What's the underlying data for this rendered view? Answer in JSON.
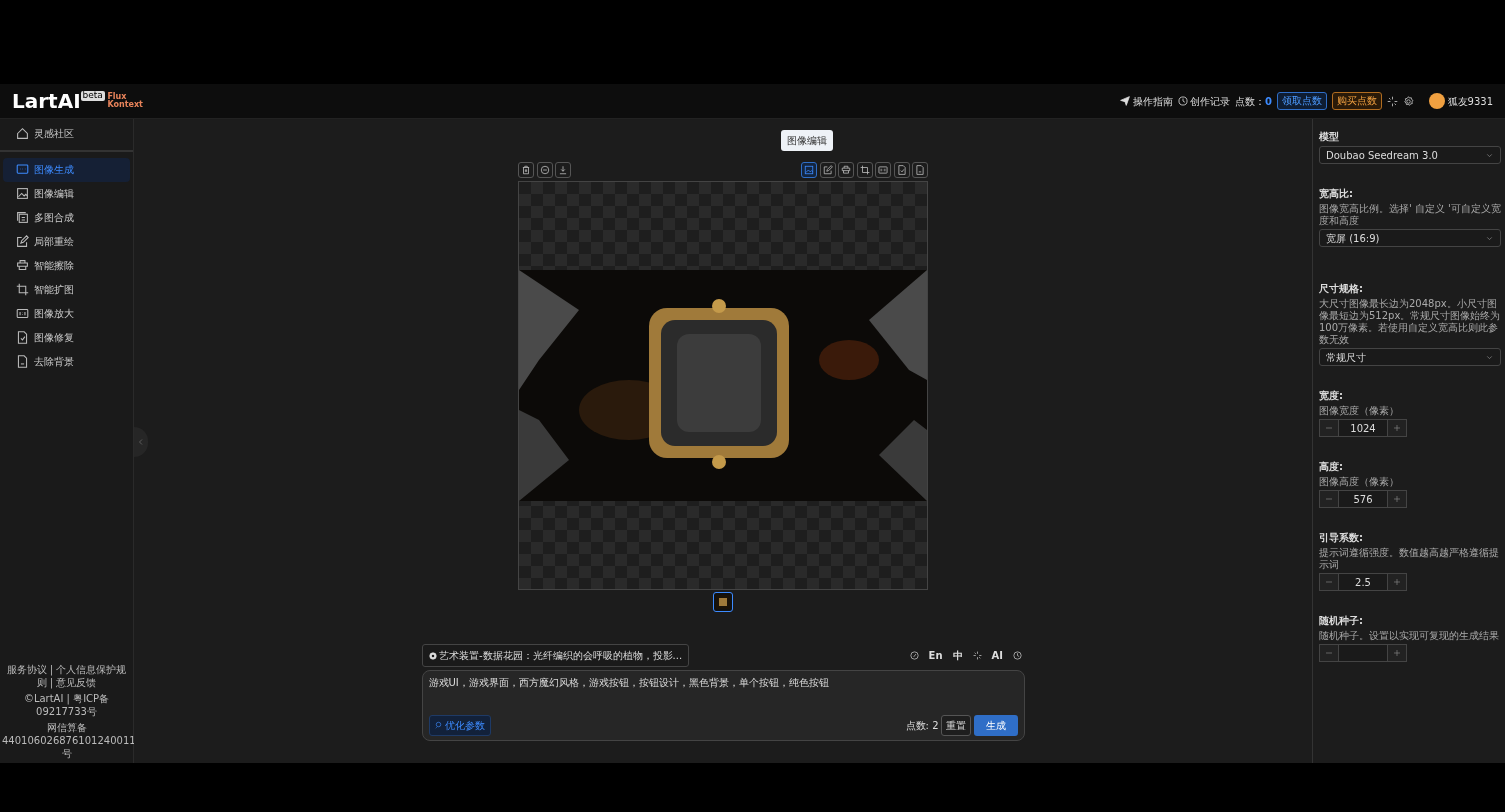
{
  "header": {
    "logo": "LartAI",
    "logo_badge": "beta",
    "product": [
      "Flux",
      "Kontext"
    ],
    "links": [
      {
        "label": "操作指南"
      },
      {
        "label": "创作记录"
      }
    ],
    "points_label": "点数：",
    "points_value": "0",
    "buttons": [
      {
        "label": "领取点数",
        "kind": "claim"
      },
      {
        "label": "购买点数",
        "kind": "buy"
      }
    ],
    "username": "狐友9331"
  },
  "sidebar": {
    "top": {
      "label": "灵感社区"
    },
    "items": [
      {
        "label": "图像生成",
        "selected": true
      },
      {
        "label": "图像编辑",
        "selected": false
      },
      {
        "label": "多图合成",
        "selected": false
      },
      {
        "label": "局部重绘",
        "selected": false
      },
      {
        "label": "智能擦除",
        "selected": false
      },
      {
        "label": "智能扩图",
        "selected": false
      },
      {
        "label": "图像放大",
        "selected": false
      },
      {
        "label": "图像修复",
        "selected": false
      },
      {
        "label": "去除背景",
        "selected": false
      }
    ],
    "footer": [
      "服务协议 | 个人信息保护规则 | 意见反馈",
      "©LartAI | 粤ICP备09217733号",
      "网信算备440106026876101240011号"
    ]
  },
  "toolbar": {
    "left": [
      {
        "selected": false
      },
      {
        "selected": false
      },
      {
        "selected": false
      }
    ],
    "right": [
      {
        "selected": true
      },
      {
        "selected": false
      },
      {
        "selected": false
      },
      {
        "selected": false
      },
      {
        "selected": false
      },
      {
        "selected": false
      },
      {
        "selected": false
      }
    ],
    "tooltip": "图像编辑"
  },
  "canvas": {
    "thumbnails": [
      {
        "selected": true
      }
    ]
  },
  "prompt": {
    "template": "艺术装置-数据花园：光纤编织的会呼吸的植物，投影...",
    "tools": [
      "En",
      "中",
      "AI"
    ],
    "value": "游戏UI，游戏界面，西方魔幻风格，游戏按钮，按钮设计，黑色背景，单个按钮，纯色按钮",
    "optimize": "优化参数",
    "cost": "点数: 2",
    "reset": "重置",
    "generate": "生成"
  },
  "settings": [
    {
      "kind": "select",
      "label": "模型",
      "value": "Doubao Seedream 3.0"
    },
    {
      "kind": "select",
      "label": "宽高比:",
      "help": "图像宽高比例。选择' 自定义 '可自定义宽度和高度",
      "value": "宽屏 (16:9)"
    },
    {
      "kind": "select",
      "label": "尺寸规格:",
      "help": "大尺寸图像最长边为2048px。小尺寸图像最短边为512px。常规尺寸图像始终为100万像素。若使用自定义宽高比则此参数无效",
      "value": "常规尺寸"
    },
    {
      "kind": "stepper",
      "label": "宽度:",
      "help": "图像宽度（像素）",
      "value": "1024"
    },
    {
      "kind": "stepper",
      "label": "高度:",
      "help": "图像高度（像素）",
      "value": "576"
    },
    {
      "kind": "stepper",
      "label": "引导系数:",
      "help": "提示词遵循强度。数值越高越严格遵循提示词",
      "value": "2.5"
    },
    {
      "kind": "stepper",
      "label": "随机种子:",
      "help": "随机种子。设置以实现可复现的生成结果"
    }
  ]
}
